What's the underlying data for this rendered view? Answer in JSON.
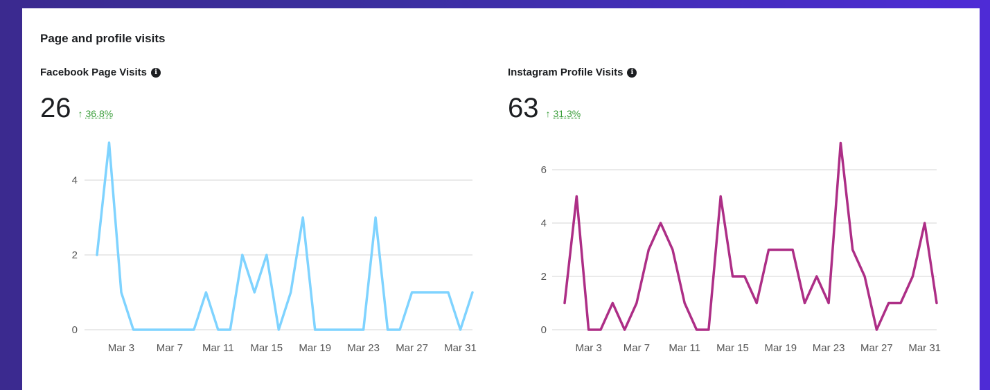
{
  "section_title": "Page and profile visits",
  "colors": {
    "facebook_line": "#7fd3ff",
    "instagram_line": "#ad2e86",
    "delta_up": "#3a9e3a",
    "grid": "#e4e4e4"
  },
  "panels": [
    {
      "title": "Facebook Page Visits",
      "info_icon": "info-icon",
      "value": "26",
      "delta_arrow": "↑",
      "delta": "36.8%"
    },
    {
      "title": "Instagram Profile Visits",
      "info_icon": "info-icon",
      "value": "63",
      "delta_arrow": "↑",
      "delta": "31.3%"
    }
  ],
  "chart_data": [
    {
      "type": "line",
      "title": "Facebook Page Visits",
      "x": [
        "Mar 1",
        "Mar 2",
        "Mar 3",
        "Mar 4",
        "Mar 5",
        "Mar 6",
        "Mar 7",
        "Mar 8",
        "Mar 9",
        "Mar 10",
        "Mar 11",
        "Mar 12",
        "Mar 13",
        "Mar 14",
        "Mar 15",
        "Mar 16",
        "Mar 17",
        "Mar 18",
        "Mar 19",
        "Mar 20",
        "Mar 21",
        "Mar 22",
        "Mar 23",
        "Mar 24",
        "Mar 25",
        "Mar 26",
        "Mar 27",
        "Mar 28",
        "Mar 29",
        "Mar 30",
        "Mar 31",
        "Apr 1"
      ],
      "x_tick_labels": [
        "Mar 3",
        "Mar 7",
        "Mar 11",
        "Mar 15",
        "Mar 19",
        "Mar 23",
        "Mar 27",
        "Mar 31"
      ],
      "series": [
        {
          "values": [
            2,
            5,
            1,
            0,
            0,
            0,
            0,
            0,
            0,
            1,
            0,
            0,
            2,
            1,
            2,
            0,
            1,
            3,
            0,
            0,
            0,
            0,
            0,
            3,
            0,
            0,
            1,
            1,
            1,
            1,
            0,
            1
          ]
        }
      ],
      "yticks": [
        0,
        2,
        4
      ],
      "ylim": [
        0,
        5
      ],
      "grid": true,
      "color": "#7fd3ff"
    },
    {
      "type": "line",
      "title": "Instagram Profile Visits",
      "x": [
        "Mar 1",
        "Mar 2",
        "Mar 3",
        "Mar 4",
        "Mar 5",
        "Mar 6",
        "Mar 7",
        "Mar 8",
        "Mar 9",
        "Mar 10",
        "Mar 11",
        "Mar 12",
        "Mar 13",
        "Mar 14",
        "Mar 15",
        "Mar 16",
        "Mar 17",
        "Mar 18",
        "Mar 19",
        "Mar 20",
        "Mar 21",
        "Mar 22",
        "Mar 23",
        "Mar 24",
        "Mar 25",
        "Mar 26",
        "Mar 27",
        "Mar 28",
        "Mar 29",
        "Mar 30",
        "Mar 31",
        "Apr 1"
      ],
      "x_tick_labels": [
        "Mar 3",
        "Mar 7",
        "Mar 11",
        "Mar 15",
        "Mar 19",
        "Mar 23",
        "Mar 27",
        "Mar 31"
      ],
      "series": [
        {
          "values": [
            1,
            5,
            0,
            0,
            1,
            0,
            1,
            3,
            4,
            3,
            1,
            0,
            0,
            5,
            2,
            2,
            1,
            3,
            3,
            3,
            1,
            2,
            1,
            7,
            3,
            2,
            0,
            1,
            1,
            2,
            4,
            1
          ]
        }
      ],
      "yticks": [
        0,
        2,
        4,
        6
      ],
      "ylim": [
        0,
        7
      ],
      "grid": true,
      "color": "#ad2e86"
    }
  ]
}
